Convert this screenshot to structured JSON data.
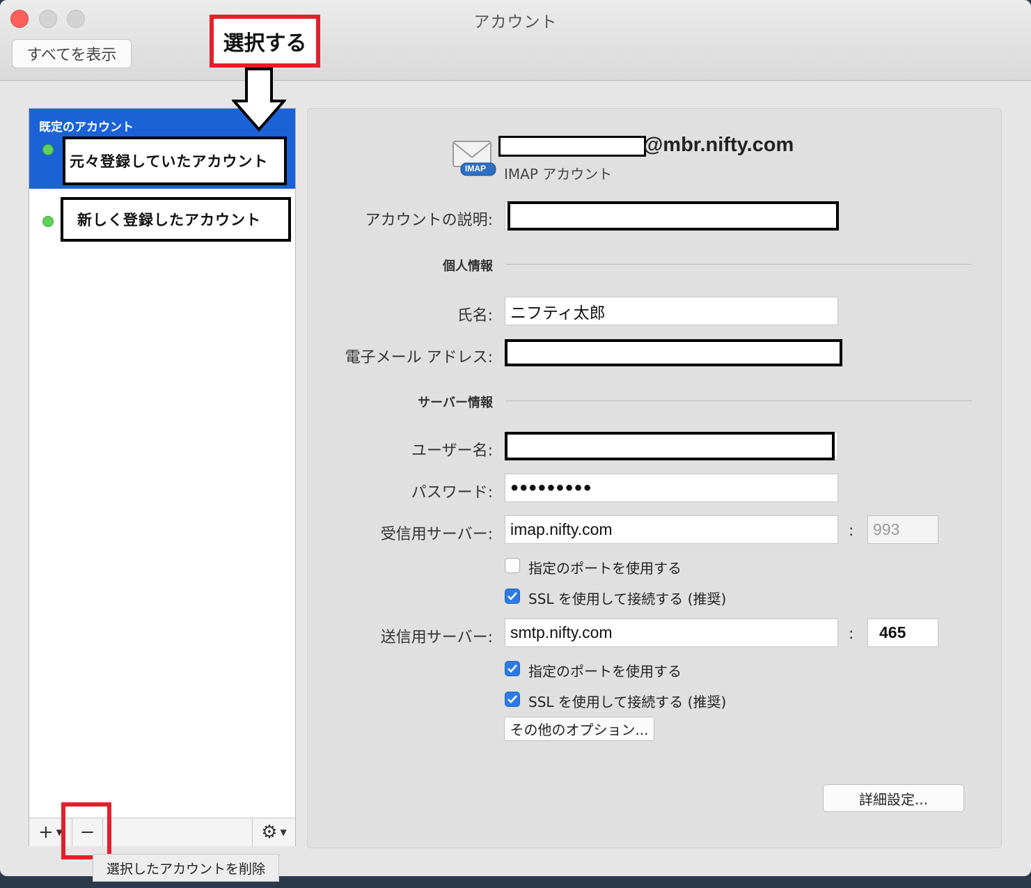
{
  "window": {
    "title": "アカウント",
    "show_all": "すべてを表示"
  },
  "annotations": {
    "select_label": "選択する"
  },
  "sidebar": {
    "header": "既定のアカウント",
    "accounts": [
      {
        "label": "元々登録していたアカウント",
        "status": "online"
      },
      {
        "label": "新しく登録したアカウント",
        "status": "online"
      }
    ],
    "toolbar": {
      "add": "+",
      "remove": "−",
      "gear": "⚙"
    },
    "tooltip": "選択したアカウントを削除"
  },
  "account": {
    "email_suffix": "@mbr.nifty.com",
    "type": "IMAP アカウント",
    "icon_badge": "IMAP",
    "description_label": "アカウントの説明:",
    "personal_section": "個人情報",
    "name_label": "氏名:",
    "name_value": "ニフティ太郎",
    "email_label": "電子メール アドレス:",
    "server_section": "サーバー情報",
    "username_label": "ユーザー名:",
    "password_label": "パスワード:",
    "password_value": "●●●●●●●●●",
    "incoming_label": "受信用サーバー:",
    "incoming_value": "imap.nifty.com",
    "incoming_port": "993",
    "incoming_custom_port": "指定のポートを使用する",
    "incoming_ssl": "SSL を使用して接続する (推奨)",
    "outgoing_label": "送信用サーバー:",
    "outgoing_value": "smtp.nifty.com",
    "outgoing_port": "465",
    "outgoing_custom_port": "指定のポートを使用する",
    "outgoing_ssl": "SSL を使用して接続する (推奨)",
    "more_options": "その他のオプション...",
    "advanced": "詳細設定...",
    "colon": ":"
  },
  "colors": {
    "selection": "#1a62d6",
    "annotation_red": "#e3202a",
    "checkbox_blue": "#2b7be5",
    "status_green": "#5fd05a"
  }
}
